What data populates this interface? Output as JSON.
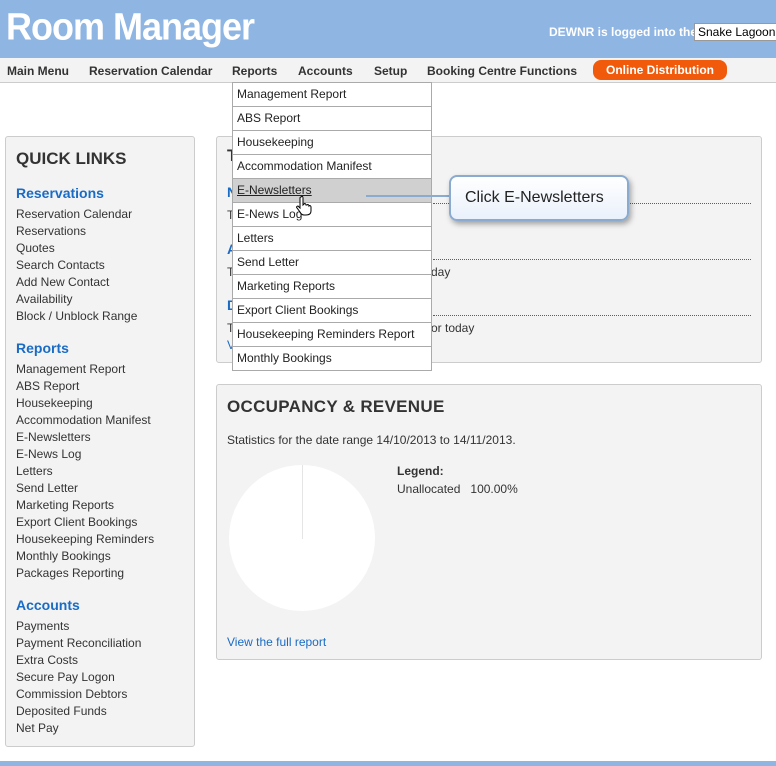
{
  "header": {
    "app_title": "Room Manager",
    "user": "DEWNR",
    "login_suffix": "is logged into the",
    "property": "Snake Lagoon"
  },
  "nav": {
    "items": [
      "Main Menu",
      "Reservation Calendar",
      "Reports",
      "Accounts",
      "Setup",
      "Booking Centre Functions"
    ],
    "online": "Online Distribution"
  },
  "reports_menu": {
    "items": [
      "Management Report",
      "ABS Report",
      "Housekeeping",
      "Accommodation Manifest",
      "E-Newsletters",
      "E-News Log",
      "Letters",
      "Send Letter",
      "Marketing Reports",
      "Export Client Bookings",
      "Housekeeping Reminders Report",
      "Monthly Bookings"
    ],
    "highlighted": "E-Newsletters"
  },
  "callout": {
    "text": "Click E-Newsletters"
  },
  "quick_links": {
    "title": "QUICK LINKS",
    "reservations": {
      "heading": "Reservations",
      "items": [
        "Reservation Calendar",
        "Reservations",
        "Quotes",
        "Search Contacts",
        "Add New Contact",
        "Availability",
        "Block / Unblock Range"
      ]
    },
    "reports": {
      "heading": "Reports",
      "items": [
        "Management Report",
        "ABS Report",
        "Housekeeping",
        "Accommodation Manifest",
        "E-Newsletters",
        "E-News Log",
        "Letters",
        "Send Letter",
        "Marketing Reports",
        "Export Client Bookings",
        "Housekeeping Reminders",
        "Monthly Bookings",
        "Packages Reporting"
      ]
    },
    "accounts": {
      "heading": "Accounts",
      "items": [
        "Payments",
        "Payment Reconciliation",
        "Extra Costs",
        "Secure Pay Logon",
        "Commission Debtors",
        "Deposited Funds",
        "Net Pay"
      ]
    }
  },
  "top_panel": {
    "fragments": [
      "T",
      "N",
      "T",
      "A",
      "T",
      "day",
      "D",
      "T",
      "or today",
      "V"
    ]
  },
  "occupancy": {
    "title": "OCCUPANCY & REVENUE",
    "stats": "Statistics for the date range 14/10/2013 to 14/11/2013.",
    "legend_title": "Legend:",
    "legend_label": "Unallocated",
    "legend_value": "100.00%",
    "link": "View the full report"
  },
  "colors": {
    "header_bg": "#8fb5e3",
    "accent_blue": "#1a6bc4",
    "online_button": "#f05a0a"
  }
}
